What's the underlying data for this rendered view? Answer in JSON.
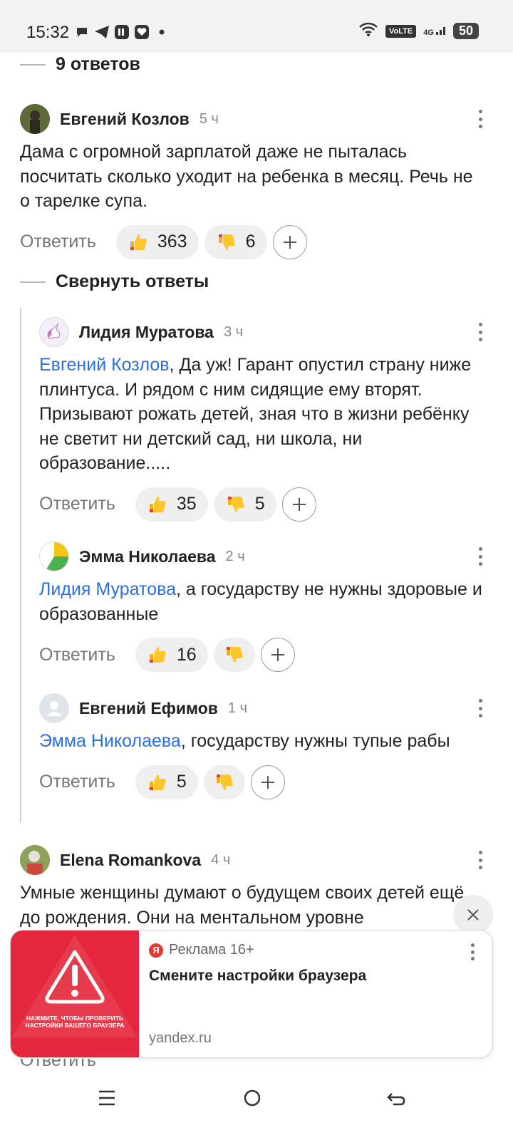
{
  "status_bar": {
    "time": "15:32",
    "volte": "VoLTE",
    "network": "4G",
    "battery": "50"
  },
  "thread": {
    "replies_count": "9 ответов",
    "collapse_label": "Свернуть ответы"
  },
  "comments": [
    {
      "author": "Евгений Козлов",
      "time": "5 ч",
      "mention": "",
      "text": "Дама с огромной зарплатой даже не пыталась посчитать сколько уходит на ребенка в месяц. Речь не о тарелке супа.",
      "reply_label": "Ответить",
      "likes": "363",
      "dislikes": "6"
    },
    {
      "author": "Лидия Муратова",
      "time": "3 ч",
      "mention": "Евгений Козлов",
      "text": ", Да уж! Гарант опустил страну ниже плинтуса. И рядом с ним сидящие ему вторят. Призывают рожать детей, зная что в жизни ребёнку не светит ни детский сад, ни школа, ни образование.....",
      "reply_label": "Ответить",
      "likes": "35",
      "dislikes": "5"
    },
    {
      "author": "Эмма Николаева",
      "time": "2 ч",
      "mention": "Лидия Муратова",
      "text": ", а государству не нужны здоровые и образованные",
      "reply_label": "Ответить",
      "likes": "16",
      "dislikes": ""
    },
    {
      "author": "Евгений Ефимов",
      "time": "1 ч",
      "mention": "Эмма Николаева",
      "text": ", государству нужны тупые рабы",
      "reply_label": "Ответить",
      "likes": "5",
      "dislikes": ""
    },
    {
      "author": "Elena Romankova",
      "time": "4 ч",
      "mention": "",
      "text": "Умные женщины думают о будущем своих детей ещё до рождения. Они на ментальном уровне",
      "reply_label": "Ответить",
      "likes": "",
      "dislikes": ""
    }
  ],
  "ad": {
    "label": "Реклама 16+",
    "ya_letter": "Я",
    "title": "Смените настройки браузера",
    "domain": "yandex.ru",
    "image_text": "НАЖМИТЕ, ЧТОБЫ ПРОВЕРИТЬ НАСТРОЙКИ ВАШЕГО БРАУЗЕРА"
  },
  "peek": {
    "reply_label": "Ответить"
  },
  "colors": {
    "mention": "#2a6fe0",
    "ad_red": "#e4273c",
    "pill_bg": "#efefef"
  }
}
